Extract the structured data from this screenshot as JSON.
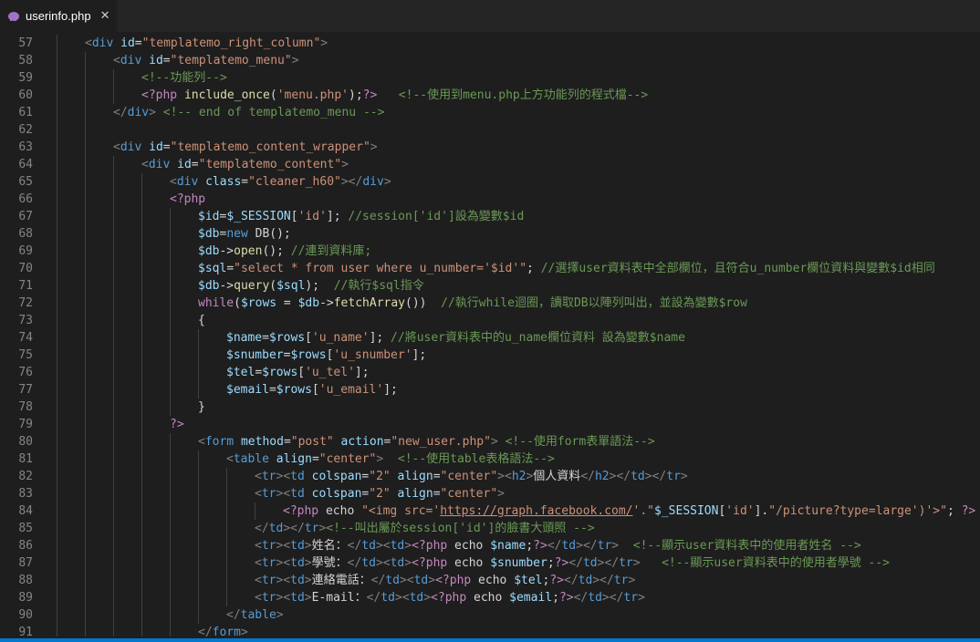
{
  "tab": {
    "title": "userinfo.php",
    "icon": "php-elephant-icon",
    "close_icon": "close-icon",
    "close_glyph": "✕"
  },
  "code_lines": [
    {
      "n": "57",
      "i": 1,
      "t": [
        [
          "p",
          "<"
        ],
        [
          "k",
          "div"
        ],
        [
          "a",
          " id"
        ],
        [
          "n",
          "="
        ],
        [
          "s",
          "\"templatemo_right_column\""
        ],
        [
          "p",
          ">"
        ]
      ]
    },
    {
      "n": "58",
      "i": 2,
      "t": [
        [
          "p",
          "<"
        ],
        [
          "k",
          "div"
        ],
        [
          "a",
          " id"
        ],
        [
          "n",
          "="
        ],
        [
          "s",
          "\"templatemo_menu\""
        ],
        [
          "p",
          ">"
        ]
      ]
    },
    {
      "n": "59",
      "i": 3,
      "t": [
        [
          "c",
          "<!--功能列-->"
        ]
      ]
    },
    {
      "n": "60",
      "i": 3,
      "t": [
        [
          "h",
          "<?php"
        ],
        [
          "f",
          " include_once"
        ],
        [
          "n",
          "("
        ],
        [
          "s",
          "'menu.php'"
        ],
        [
          "n",
          ");"
        ],
        [
          "h",
          "?>"
        ],
        [
          "n",
          "   "
        ],
        [
          "c",
          "<!--使用到menu.php上方功能列的程式檔-->"
        ]
      ]
    },
    {
      "n": "61",
      "i": 2,
      "t": [
        [
          "p",
          "</"
        ],
        [
          "k",
          "div"
        ],
        [
          "p",
          ">"
        ],
        [
          "n",
          " "
        ],
        [
          "c",
          "<!-- end of templatemo_menu -->"
        ]
      ]
    },
    {
      "n": "62",
      "i": 2,
      "t": []
    },
    {
      "n": "63",
      "i": 2,
      "t": [
        [
          "p",
          "<"
        ],
        [
          "k",
          "div"
        ],
        [
          "a",
          " id"
        ],
        [
          "n",
          "="
        ],
        [
          "s",
          "\"templatemo_content_wrapper\""
        ],
        [
          "p",
          ">"
        ]
      ]
    },
    {
      "n": "64",
      "i": 3,
      "t": [
        [
          "p",
          "<"
        ],
        [
          "k",
          "div"
        ],
        [
          "a",
          " id"
        ],
        [
          "n",
          "="
        ],
        [
          "s",
          "\"templatemo_content\""
        ],
        [
          "p",
          ">"
        ]
      ]
    },
    {
      "n": "65",
      "i": 4,
      "t": [
        [
          "p",
          "<"
        ],
        [
          "k",
          "div"
        ],
        [
          "a",
          " class"
        ],
        [
          "n",
          "="
        ],
        [
          "s",
          "\"cleaner_h60\""
        ],
        [
          "p",
          "></"
        ],
        [
          "k",
          "div"
        ],
        [
          "p",
          ">"
        ]
      ]
    },
    {
      "n": "66",
      "i": 4,
      "t": [
        [
          "h",
          "<?php"
        ]
      ]
    },
    {
      "n": "67",
      "i": 5,
      "t": [
        [
          "v",
          "$id"
        ],
        [
          "n",
          "="
        ],
        [
          "v",
          "$_SESSION"
        ],
        [
          "n",
          "["
        ],
        [
          "s",
          "'id'"
        ],
        [
          "n",
          "]; "
        ],
        [
          "c",
          "//session['id']設為變數$id"
        ]
      ]
    },
    {
      "n": "68",
      "i": 5,
      "t": [
        [
          "v",
          "$db"
        ],
        [
          "n",
          "="
        ],
        [
          "k",
          "new"
        ],
        [
          "n",
          " DB();"
        ]
      ]
    },
    {
      "n": "69",
      "i": 5,
      "t": [
        [
          "v",
          "$db"
        ],
        [
          "n",
          "->"
        ],
        [
          "f",
          "open"
        ],
        [
          "n",
          "(); "
        ],
        [
          "c",
          "//連到資料庫;"
        ]
      ]
    },
    {
      "n": "70",
      "i": 5,
      "t": [
        [
          "v",
          "$sql"
        ],
        [
          "n",
          "="
        ],
        [
          "s",
          "\"select * from user where u_number='$id'\""
        ],
        [
          "n",
          "; "
        ],
        [
          "c",
          "//選擇user資料表中全部欄位，且符合u_number欄位資料與變數$id相同"
        ]
      ]
    },
    {
      "n": "71",
      "i": 5,
      "t": [
        [
          "v",
          "$db"
        ],
        [
          "n",
          "->"
        ],
        [
          "f",
          "query"
        ],
        [
          "n",
          "("
        ],
        [
          "v",
          "$sql"
        ],
        [
          "n",
          ");  "
        ],
        [
          "c",
          "//執行$sql指令"
        ]
      ]
    },
    {
      "n": "72",
      "i": 5,
      "t": [
        [
          "h",
          "while"
        ],
        [
          "n",
          "("
        ],
        [
          "v",
          "$rows"
        ],
        [
          "n",
          " = "
        ],
        [
          "v",
          "$db"
        ],
        [
          "n",
          "->"
        ],
        [
          "f",
          "fetchArray"
        ],
        [
          "n",
          "())  "
        ],
        [
          "c",
          "//執行while迴圈，讀取DB以陣列叫出，並設為變數$row"
        ]
      ]
    },
    {
      "n": "73",
      "i": 5,
      "t": [
        [
          "n",
          "{"
        ]
      ]
    },
    {
      "n": "74",
      "i": 6,
      "t": [
        [
          "v",
          "$name"
        ],
        [
          "n",
          "="
        ],
        [
          "v",
          "$rows"
        ],
        [
          "n",
          "["
        ],
        [
          "s",
          "'u_name'"
        ],
        [
          "n",
          "]; "
        ],
        [
          "c",
          "//將user資料表中的u_name欄位資料 設為變數$name"
        ]
      ]
    },
    {
      "n": "75",
      "i": 6,
      "t": [
        [
          "v",
          "$snumber"
        ],
        [
          "n",
          "="
        ],
        [
          "v",
          "$rows"
        ],
        [
          "n",
          "["
        ],
        [
          "s",
          "'u_snumber'"
        ],
        [
          "n",
          "];"
        ]
      ]
    },
    {
      "n": "76",
      "i": 6,
      "t": [
        [
          "v",
          "$tel"
        ],
        [
          "n",
          "="
        ],
        [
          "v",
          "$rows"
        ],
        [
          "n",
          "["
        ],
        [
          "s",
          "'u_tel'"
        ],
        [
          "n",
          "];"
        ]
      ]
    },
    {
      "n": "77",
      "i": 6,
      "t": [
        [
          "v",
          "$email"
        ],
        [
          "n",
          "="
        ],
        [
          "v",
          "$rows"
        ],
        [
          "n",
          "["
        ],
        [
          "s",
          "'u_email'"
        ],
        [
          "n",
          "];"
        ]
      ]
    },
    {
      "n": "78",
      "i": 5,
      "t": [
        [
          "n",
          "}"
        ]
      ]
    },
    {
      "n": "79",
      "i": 4,
      "t": [
        [
          "h",
          "?>"
        ]
      ]
    },
    {
      "n": "80",
      "i": 5,
      "t": [
        [
          "p",
          "<"
        ],
        [
          "k",
          "form"
        ],
        [
          "a",
          " method"
        ],
        [
          "n",
          "="
        ],
        [
          "s",
          "\"post\""
        ],
        [
          "a",
          " action"
        ],
        [
          "n",
          "="
        ],
        [
          "s",
          "\"new_user.php\""
        ],
        [
          "p",
          ">"
        ],
        [
          "n",
          " "
        ],
        [
          "c",
          "<!--使用form表單語法-->"
        ]
      ]
    },
    {
      "n": "81",
      "i": 6,
      "t": [
        [
          "p",
          "<"
        ],
        [
          "k",
          "table"
        ],
        [
          "a",
          " align"
        ],
        [
          "n",
          "="
        ],
        [
          "s",
          "\"center\""
        ],
        [
          "p",
          ">"
        ],
        [
          "n",
          "  "
        ],
        [
          "c",
          "<!--使用table表格語法-->"
        ]
      ]
    },
    {
      "n": "82",
      "i": 7,
      "t": [
        [
          "p",
          "<"
        ],
        [
          "k",
          "tr"
        ],
        [
          "p",
          "><"
        ],
        [
          "k",
          "td"
        ],
        [
          "a",
          " colspan"
        ],
        [
          "n",
          "="
        ],
        [
          "s",
          "\"2\""
        ],
        [
          "a",
          " align"
        ],
        [
          "n",
          "="
        ],
        [
          "s",
          "\"center\""
        ],
        [
          "p",
          "><"
        ],
        [
          "k",
          "h2"
        ],
        [
          "p",
          ">"
        ],
        [
          "n",
          "個人資料"
        ],
        [
          "p",
          "</"
        ],
        [
          "k",
          "h2"
        ],
        [
          "p",
          "></"
        ],
        [
          "k",
          "td"
        ],
        [
          "p",
          "></"
        ],
        [
          "k",
          "tr"
        ],
        [
          "p",
          ">"
        ]
      ]
    },
    {
      "n": "83",
      "i": 7,
      "t": [
        [
          "p",
          "<"
        ],
        [
          "k",
          "tr"
        ],
        [
          "p",
          "><"
        ],
        [
          "k",
          "td"
        ],
        [
          "a",
          " colspan"
        ],
        [
          "n",
          "="
        ],
        [
          "s",
          "\"2\""
        ],
        [
          "a",
          " align"
        ],
        [
          "n",
          "="
        ],
        [
          "s",
          "\"center\""
        ],
        [
          "p",
          ">"
        ]
      ]
    },
    {
      "n": "84",
      "i": 8,
      "t": [
        [
          "h",
          "<?php"
        ],
        [
          "n",
          " echo "
        ],
        [
          "s",
          "\"<img src='"
        ],
        [
          "u",
          "https://graph.facebook.com/"
        ],
        [
          "s",
          "'.\""
        ],
        [
          "v",
          "$_SESSION"
        ],
        [
          "n",
          "["
        ],
        [
          "s",
          "'id'"
        ],
        [
          "n",
          "]."
        ],
        [
          "s",
          "\"/picture?type=large')'>\""
        ],
        [
          "n",
          "; "
        ],
        [
          "h",
          "?>"
        ]
      ]
    },
    {
      "n": "85",
      "i": 7,
      "t": [
        [
          "p",
          "</"
        ],
        [
          "k",
          "td"
        ],
        [
          "p",
          "></"
        ],
        [
          "k",
          "tr"
        ],
        [
          "p",
          ">"
        ],
        [
          "c",
          "<!--叫出屬於session['id']的臉書大頭照 -->"
        ]
      ]
    },
    {
      "n": "86",
      "i": 7,
      "t": [
        [
          "p",
          "<"
        ],
        [
          "k",
          "tr"
        ],
        [
          "p",
          "><"
        ],
        [
          "k",
          "td"
        ],
        [
          "p",
          ">"
        ],
        [
          "n",
          "姓名："
        ],
        [
          "p",
          "</"
        ],
        [
          "k",
          "td"
        ],
        [
          "p",
          "><"
        ],
        [
          "k",
          "td"
        ],
        [
          "p",
          ">"
        ],
        [
          "h",
          "<?php"
        ],
        [
          "n",
          " echo "
        ],
        [
          "v",
          "$name"
        ],
        [
          "n",
          ";"
        ],
        [
          "h",
          "?>"
        ],
        [
          "p",
          "</"
        ],
        [
          "k",
          "td"
        ],
        [
          "p",
          "></"
        ],
        [
          "k",
          "tr"
        ],
        [
          "p",
          ">"
        ],
        [
          "n",
          "  "
        ],
        [
          "c",
          "<!--顯示user資料表中的使用者姓名 -->"
        ]
      ]
    },
    {
      "n": "87",
      "i": 7,
      "t": [
        [
          "p",
          "<"
        ],
        [
          "k",
          "tr"
        ],
        [
          "p",
          "><"
        ],
        [
          "k",
          "td"
        ],
        [
          "p",
          ">"
        ],
        [
          "n",
          "學號："
        ],
        [
          "p",
          "</"
        ],
        [
          "k",
          "td"
        ],
        [
          "p",
          "><"
        ],
        [
          "k",
          "td"
        ],
        [
          "p",
          ">"
        ],
        [
          "h",
          "<?php"
        ],
        [
          "n",
          " echo "
        ],
        [
          "v",
          "$snumber"
        ],
        [
          "n",
          ";"
        ],
        [
          "h",
          "?>"
        ],
        [
          "p",
          "</"
        ],
        [
          "k",
          "td"
        ],
        [
          "p",
          "></"
        ],
        [
          "k",
          "tr"
        ],
        [
          "p",
          ">"
        ],
        [
          "n",
          "   "
        ],
        [
          "c",
          "<!--顯示user資料表中的使用者學號 -->"
        ]
      ]
    },
    {
      "n": "88",
      "i": 7,
      "t": [
        [
          "p",
          "<"
        ],
        [
          "k",
          "tr"
        ],
        [
          "p",
          "><"
        ],
        [
          "k",
          "td"
        ],
        [
          "p",
          ">"
        ],
        [
          "n",
          "連絡電話："
        ],
        [
          "p",
          "</"
        ],
        [
          "k",
          "td"
        ],
        [
          "p",
          "><"
        ],
        [
          "k",
          "td"
        ],
        [
          "p",
          ">"
        ],
        [
          "h",
          "<?php"
        ],
        [
          "n",
          " echo "
        ],
        [
          "v",
          "$tel"
        ],
        [
          "n",
          ";"
        ],
        [
          "h",
          "?>"
        ],
        [
          "p",
          "</"
        ],
        [
          "k",
          "td"
        ],
        [
          "p",
          "></"
        ],
        [
          "k",
          "tr"
        ],
        [
          "p",
          ">"
        ]
      ]
    },
    {
      "n": "89",
      "i": 7,
      "t": [
        [
          "p",
          "<"
        ],
        [
          "k",
          "tr"
        ],
        [
          "p",
          "><"
        ],
        [
          "k",
          "td"
        ],
        [
          "p",
          ">"
        ],
        [
          "n",
          "E-mail："
        ],
        [
          "p",
          "</"
        ],
        [
          "k",
          "td"
        ],
        [
          "p",
          "><"
        ],
        [
          "k",
          "td"
        ],
        [
          "p",
          ">"
        ],
        [
          "h",
          "<?php"
        ],
        [
          "n",
          " echo "
        ],
        [
          "v",
          "$email"
        ],
        [
          "n",
          ";"
        ],
        [
          "h",
          "?>"
        ],
        [
          "p",
          "</"
        ],
        [
          "k",
          "td"
        ],
        [
          "p",
          "></"
        ],
        [
          "k",
          "tr"
        ],
        [
          "p",
          ">"
        ]
      ]
    },
    {
      "n": "90",
      "i": 6,
      "t": [
        [
          "p",
          "</"
        ],
        [
          "k",
          "table"
        ],
        [
          "p",
          ">"
        ]
      ]
    },
    {
      "n": "91",
      "i": 5,
      "t": [
        [
          "p",
          "</"
        ],
        [
          "k",
          "form"
        ],
        [
          "p",
          ">"
        ]
      ]
    }
  ]
}
